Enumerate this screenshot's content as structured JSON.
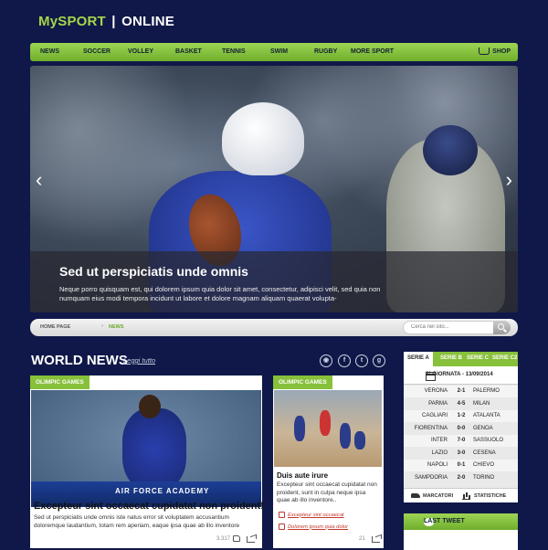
{
  "header": {
    "brand_a": "MySPORT",
    "brand_sep": "|",
    "brand_b": "ONLINE"
  },
  "nav": {
    "items": [
      "NEWS",
      "SOCCER",
      "VOLLEY",
      "BASKET",
      "TENNIS",
      "SWIM",
      "RUGBY",
      "MORE SPORT"
    ],
    "shop": "SHOP"
  },
  "hero": {
    "title": "Sed ut perspiciatis unde omnis",
    "description": "Neque porro quisquam est, qui dolorem ipsum quia dolor sit amet, consectetur, adipisci velit, sed quia non numquam eius modi tempora incidunt ut labore et dolore magnam aliquam quaerat volupta-",
    "prev": "‹",
    "next": "›"
  },
  "breadcrumb": {
    "home": "HOME PAGE",
    "sep": "›",
    "current": "NEWS",
    "search_placeholder": "Cerca nel sito..."
  },
  "world_news": {
    "title": "WORLD NEWS",
    "more": "Leggi tutto",
    "social": [
      "rss-icon",
      "facebook-icon",
      "twitter-icon",
      "googleplus-icon"
    ]
  },
  "card_main": {
    "tag": "OLIMPIC GAMES",
    "banner": "AIR FORCE ACADEMY",
    "title": "Excepteur sint occaecat cupidatat non proident!",
    "description": "Sed ut perspiciatis unde omnis iste natus error sit voluptatem accusantium doloremque laudantium, totam rem aperiam, eaque ipsa quae ab illo inventore",
    "count": "3.317"
  },
  "card_side": {
    "tag": "OLIMPIC GAMES",
    "title": "Duis aute irure",
    "description": "Excepteur sint occaecat cupidatat non proident, sunt in culpa neque ipsa quae ab illo inventore..",
    "links": [
      "Excepteur sint occaecat",
      "Dolorem ipsum quia dolor"
    ],
    "count": "21"
  },
  "serie": {
    "tabs": [
      "SERIE A",
      "SERIE B",
      "SERIE C",
      "SERIE C2"
    ],
    "giornata": "2° GIORNATA - 13/09/2014",
    "matches": [
      {
        "home": "VERONA",
        "score": "2-1",
        "away": "PALERMO"
      },
      {
        "home": "PARMA",
        "score": "4-5",
        "away": "MILAN"
      },
      {
        "home": "CAGLIARI",
        "score": "1-2",
        "away": "ATALANTA"
      },
      {
        "home": "FIORENTINA",
        "score": "0-0",
        "away": "GENOA"
      },
      {
        "home": "INTER",
        "score": "7-0",
        "away": "SASSUOLO"
      },
      {
        "home": "LAZIO",
        "score": "3-0",
        "away": "CESENA"
      },
      {
        "home": "NAPOLI",
        "score": "0-1",
        "away": "CHIEVO"
      },
      {
        "home": "SAMPDORIA",
        "score": "2-0",
        "away": "TORINO"
      }
    ],
    "marcatori": "MARCATORI",
    "statistiche": "STATISTICHE"
  },
  "tweet": {
    "title": "LAST TWEET"
  },
  "colors": {
    "background": "#0f1848",
    "accent": "#87c03b",
    "link": "#c0392b"
  }
}
